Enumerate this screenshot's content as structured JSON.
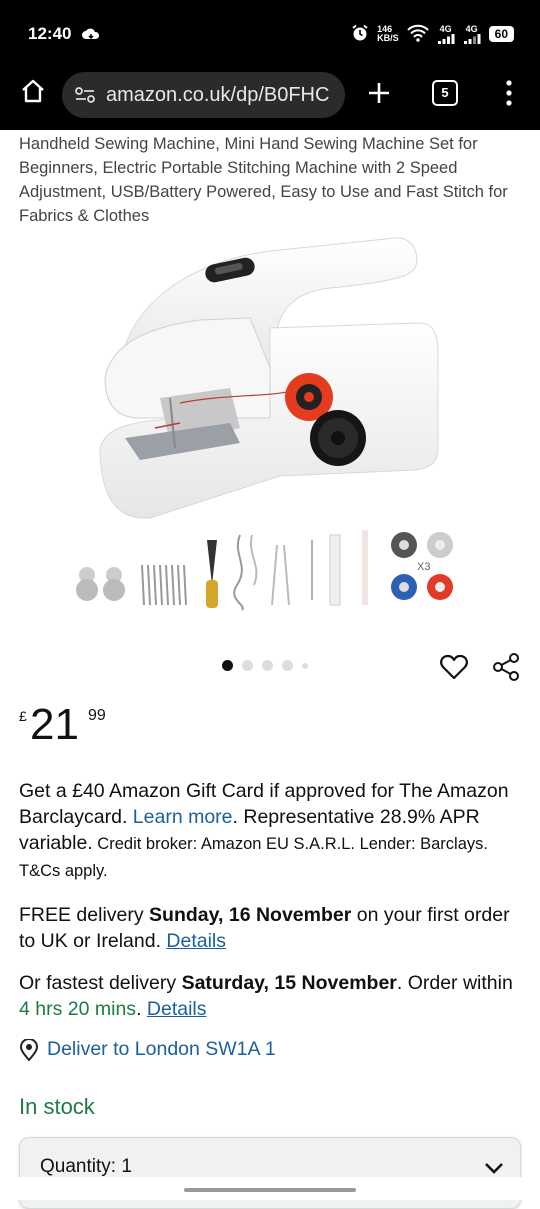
{
  "status_bar": {
    "time": "12:40",
    "net_speed_top": "146",
    "net_speed_bottom": "KB/S",
    "sig1": "4G",
    "sig2": "4G",
    "battery": "60"
  },
  "browser": {
    "url": "amazon.co.uk/dp/B0FHC",
    "tab_count": "5"
  },
  "product": {
    "title": "Handheld Sewing Machine, Mini Hand Sewing Machine Set for Beginners, Electric Portable Stitching Machine with 2 Speed Adjustment, USB/Battery Powered, Easy to Use and Fast Stitch for Fabrics & Clothes",
    "accessory_multiplier": "X3",
    "image_count": 5,
    "current_image": 1
  },
  "price": {
    "currency": "£",
    "whole": "21",
    "fraction": "99"
  },
  "offer": {
    "line1": "Get a £40 Amazon Gift Card if approved for The Amazon Barclaycard. ",
    "learn_more": "Learn more",
    "period": ".",
    "line2": " Representative 28.9% APR variable.",
    "small": " Credit broker: Amazon EU S.A.R.L. Lender: Barclays. T&Cs apply."
  },
  "delivery": {
    "free_prefix": "FREE delivery ",
    "free_date": "Sunday, 16 November",
    "free_suffix": " on your first order to UK or Ireland. ",
    "details1": "Details",
    "fast_prefix": "Or fastest delivery ",
    "fast_date": "Saturday, 15 November",
    "fast_mid": ". Order within ",
    "countdown": "4 hrs 20 mins",
    "fast_suffix": ". ",
    "details2": "Details",
    "deliver_to": "Deliver to London SW1A 1"
  },
  "stock": "In stock",
  "quantity": {
    "label": "Quantity: 1"
  }
}
